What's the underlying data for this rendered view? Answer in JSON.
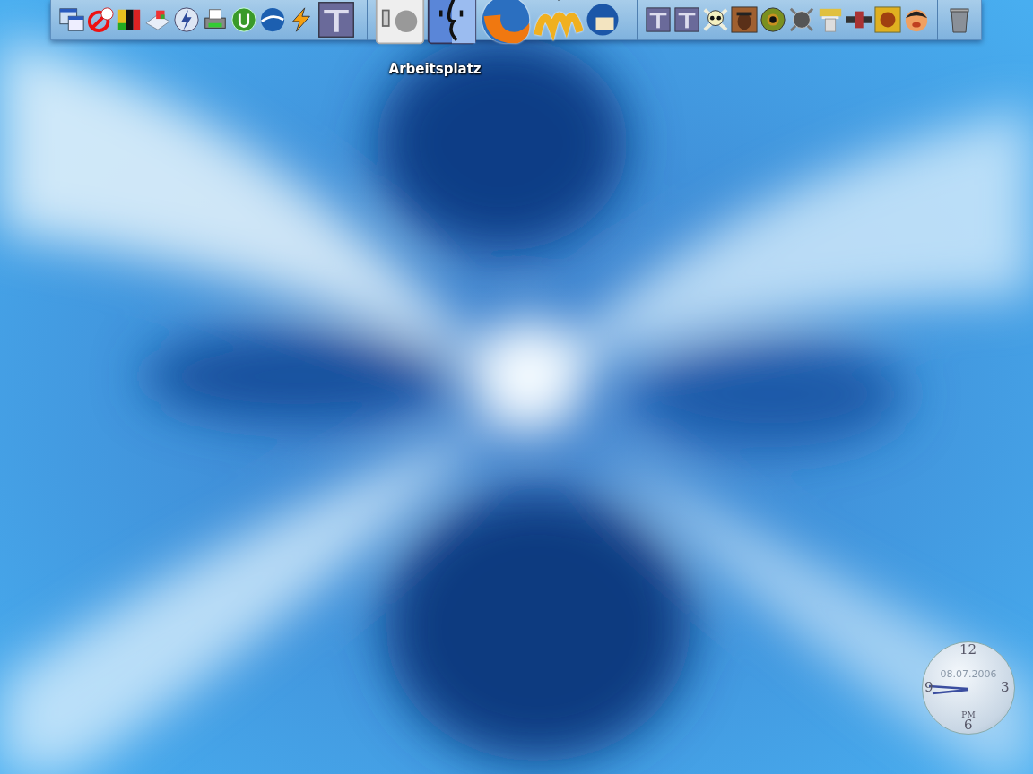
{
  "dock": {
    "sections": [
      {
        "items": [
          {
            "kind": "window",
            "running": false
          },
          {
            "kind": "blocker",
            "running": false
          },
          {
            "kind": "flag",
            "running": false
          },
          {
            "kind": "drive",
            "running": false
          },
          {
            "kind": "bolt",
            "running": false
          },
          {
            "kind": "printer",
            "running": false
          },
          {
            "kind": "torrent",
            "running": false
          },
          {
            "kind": "globe",
            "running": false
          },
          {
            "kind": "zap",
            "running": false
          },
          {
            "kind": "tile",
            "running": false
          }
        ]
      },
      {
        "items": [
          {
            "kind": "switch",
            "running": false,
            "label": "Arbeitsplatz"
          },
          {
            "kind": "finder",
            "running": false
          },
          {
            "kind": "fox",
            "running": true
          },
          {
            "kind": "wave",
            "running": true
          },
          {
            "kind": "bird",
            "running": false
          }
        ]
      },
      {
        "items": [
          {
            "kind": "tile",
            "running": false
          },
          {
            "kind": "tile",
            "running": false
          },
          {
            "kind": "skull",
            "running": false
          },
          {
            "kind": "portrait",
            "running": false
          },
          {
            "kind": "eye",
            "running": false
          },
          {
            "kind": "shield",
            "running": false
          },
          {
            "kind": "column",
            "running": false
          },
          {
            "kind": "banner",
            "running": false
          },
          {
            "kind": "emblem",
            "running": false
          },
          {
            "kind": "head",
            "running": false
          }
        ]
      },
      {
        "items": [
          {
            "kind": "trash",
            "running": false
          }
        ]
      }
    ]
  },
  "clock": {
    "date": "08.07.2006",
    "numerals": [
      "12",
      "3",
      "6",
      "9"
    ],
    "period": "PM"
  }
}
